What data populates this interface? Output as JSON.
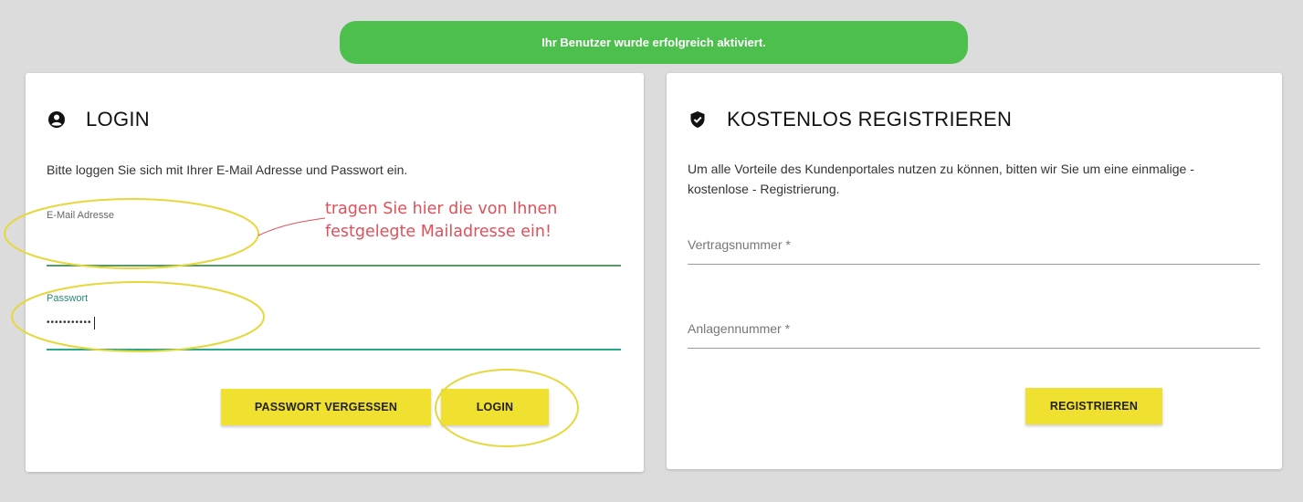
{
  "banner": {
    "text": "Ihr Benutzer wurde erfolgreich aktiviert."
  },
  "login": {
    "title": "LOGIN",
    "description": "Bitte loggen Sie sich mit Ihrer E-Mail Adresse und Passwort ein.",
    "email_label": "E-Mail Adresse",
    "email_value": "",
    "password_label": "Passwort",
    "password_value": "•••••••••••",
    "forgot_button": "PASSWORT VERGESSEN",
    "login_button": "LOGIN"
  },
  "register": {
    "title": "KOSTENLOS REGISTRIEREN",
    "description": "Um alle Vorteile des Kundenportales nutzen zu können, bitten wir Sie um eine einmalige - kostenlose - Registrierung.",
    "contract_label": "Vertragsnummer *",
    "plant_label": "Anlagennummer *",
    "register_button": "REGISTRIEREN"
  },
  "annotation": {
    "line1": "tragen Sie hier die von Ihnen",
    "line2": "festgelegte Mailadresse ein!"
  },
  "colors": {
    "banner": "#4cbf4c",
    "button": "#f0e030",
    "annotation": "#e0505a",
    "highlight_ellipse": "#e6d83a"
  }
}
